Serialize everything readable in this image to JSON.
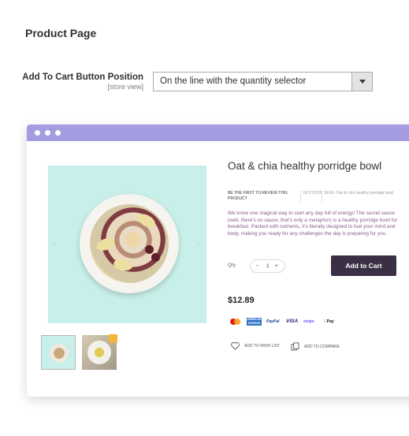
{
  "section": {
    "title": "Product Page"
  },
  "field": {
    "label": "Add To Cart Button Position",
    "scope": "[store view]",
    "value": "On the line with the quantity selector"
  },
  "preview": {
    "title": "Oat & chia healthy porridge bowl",
    "review_link": "BE THE FIRST TO REVIEW THIS PRODUCT",
    "stock": "IN STOCK",
    "sku": "SKU#: Oat & chia healthy porridge bowl",
    "description": "We know one magical way to start any day full of energy! The secret sauce (well, there's no sauce, that's only a metaphor) is a healthy porridge bowl for breakfast. Packed with nutrients, it's literally designed to fuel your mind and body, making you ready for any challenges the day is preparing for you.",
    "qty_label": "Qty",
    "qty_minus": "−",
    "qty_value": "1",
    "qty_plus": "+",
    "add_to_cart": "Add to Cart",
    "price": "$12.89",
    "wishlist": "ADD TO WISH LIST",
    "compare": "ADD TO COMPARE",
    "nav_prev": "‹",
    "nav_next": "›",
    "payments": {
      "amex": "AMERICAN EXPRESS",
      "paypal": "PayPal",
      "visa": "VISA",
      "stripe": "stripe",
      "apple": "Pay"
    }
  },
  "colors": {
    "window_bar": "#a49ce0",
    "image_bg": "#c8efe9",
    "button_bg": "#3a2f45",
    "description_text": "#8a5d86"
  },
  "icons": {
    "select_arrow": "chevron-down-icon",
    "wishlist": "heart-icon",
    "compare": "compare-icon"
  }
}
